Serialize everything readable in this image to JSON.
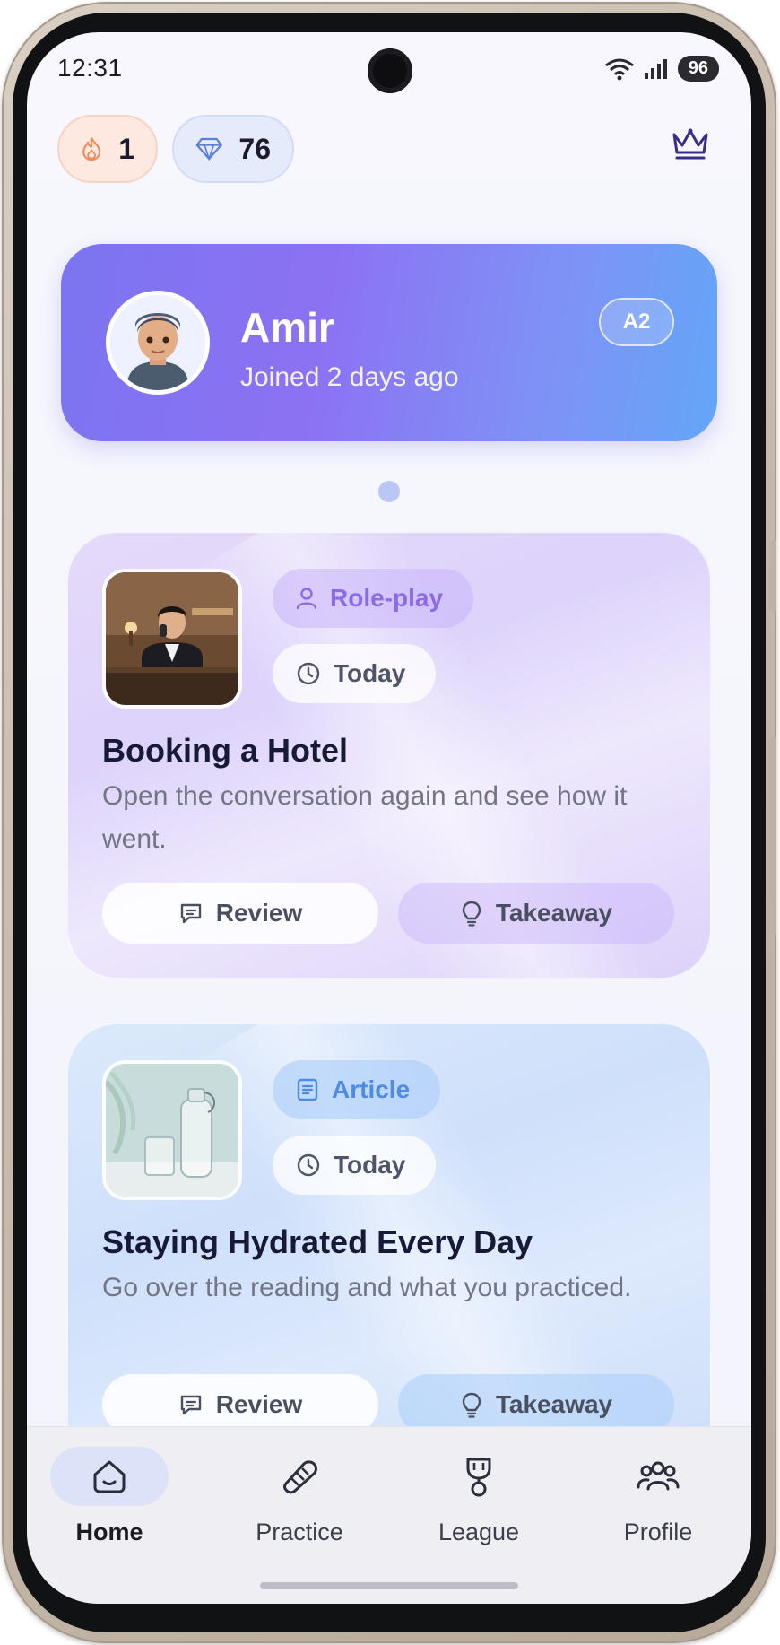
{
  "status_bar": {
    "time": "12:31",
    "battery": "96"
  },
  "header": {
    "streak_count": "1",
    "gems_count": "76",
    "streak_icon": "flame-icon",
    "gems_icon": "gem-icon",
    "premium_icon": "crown-icon"
  },
  "profile": {
    "name": "Amir",
    "joined": "Joined 2 days ago",
    "level": "A2"
  },
  "cards": [
    {
      "tag_type": "Role-play",
      "tag_date": "Today",
      "title": "Booking a Hotel",
      "description": "Open the conversation again and see how it went.",
      "review_label": "Review",
      "takeaway_label": "Takeaway"
    },
    {
      "tag_type": "Article",
      "tag_date": "Today",
      "title": "Staying Hydrated Every Day",
      "description": "Go over the reading and what you practiced.",
      "review_label": "Review",
      "takeaway_label": "Takeaway"
    }
  ],
  "nav": {
    "items": [
      {
        "label": "Home",
        "icon": "home-icon",
        "active": true
      },
      {
        "label": "Practice",
        "icon": "practice-icon",
        "active": false
      },
      {
        "label": "League",
        "icon": "trophy-icon",
        "active": false
      },
      {
        "label": "Profile",
        "icon": "users-icon",
        "active": false
      }
    ]
  },
  "colors": {
    "accent_purple": "#8a6ce6",
    "accent_blue": "#4d8be6",
    "profile_gradient_start": "#7b74f0",
    "profile_gradient_end": "#63a6f7"
  }
}
